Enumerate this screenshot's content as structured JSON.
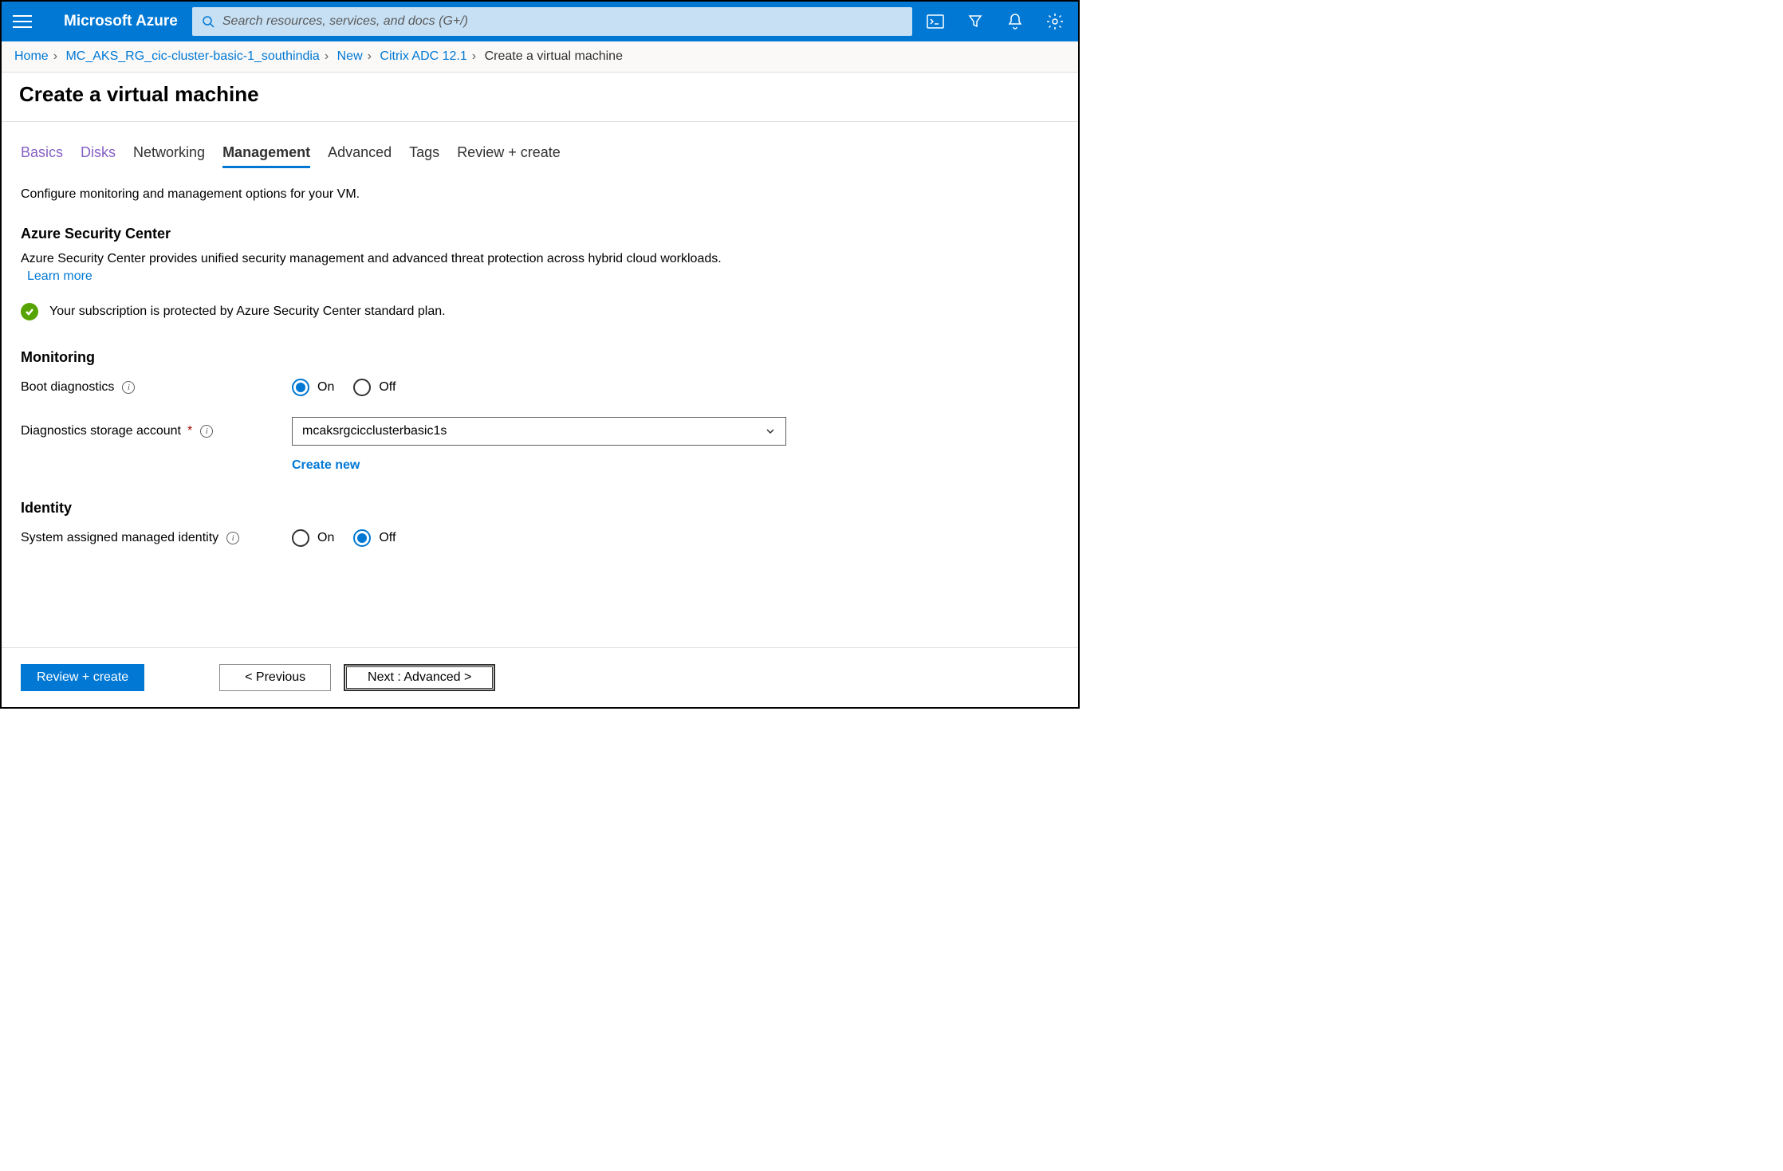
{
  "header": {
    "brand": "Microsoft Azure",
    "search_placeholder": "Search resources, services, and docs (G+/)"
  },
  "breadcrumb": {
    "items": [
      "Home",
      "MC_AKS_RG_cic-cluster-basic-1_southindia",
      "New",
      "Citrix ADC 12.1"
    ],
    "current": "Create a virtual machine"
  },
  "page": {
    "title": "Create a virtual machine"
  },
  "tabs": [
    "Basics",
    "Disks",
    "Networking",
    "Management",
    "Advanced",
    "Tags",
    "Review + create"
  ],
  "content": {
    "description": "Configure monitoring and management options for your VM.",
    "security": {
      "heading": "Azure Security Center",
      "text": "Azure Security Center provides unified security management and advanced threat protection across hybrid cloud workloads.",
      "learn_more": "Learn more",
      "status": "Your subscription is protected by Azure Security Center standard plan."
    },
    "monitoring": {
      "heading": "Monitoring",
      "boot_label": "Boot diagnostics",
      "on": "On",
      "off": "Off",
      "storage_label": "Diagnostics storage account",
      "storage_value": "mcaksrgcicclusterbasic1s",
      "create_new": "Create new"
    },
    "identity": {
      "heading": "Identity",
      "sami_label": "System assigned managed identity"
    }
  },
  "footer": {
    "review": "Review + create",
    "previous": "< Previous",
    "next": "Next : Advanced >"
  }
}
